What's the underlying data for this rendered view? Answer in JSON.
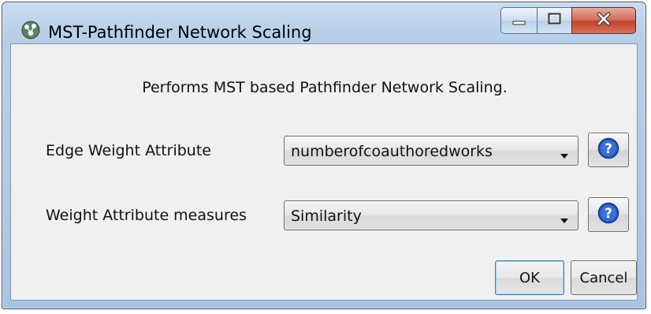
{
  "window": {
    "title": "MST-Pathfinder Network Scaling",
    "app_icon": "cytoscape-icon",
    "controls": [
      "minimize-icon",
      "maximize-icon",
      "close-icon"
    ]
  },
  "dialog": {
    "description": "Performs MST based Pathfinder Network Scaling.",
    "fields": [
      {
        "label": "Edge Weight Attribute",
        "value": "numberofcoauthoredworks",
        "help_icon": "help-icon"
      },
      {
        "label": "Weight Attribute measures",
        "value": "Similarity",
        "help_icon": "help-icon"
      }
    ],
    "ok_label": "OK",
    "cancel_label": "Cancel"
  },
  "colors": {
    "titlebar": "#b7cfe8",
    "close_button": "#c2432b",
    "client_bg": "#f0f0f0",
    "default_button_border": "#3c7fb1"
  }
}
